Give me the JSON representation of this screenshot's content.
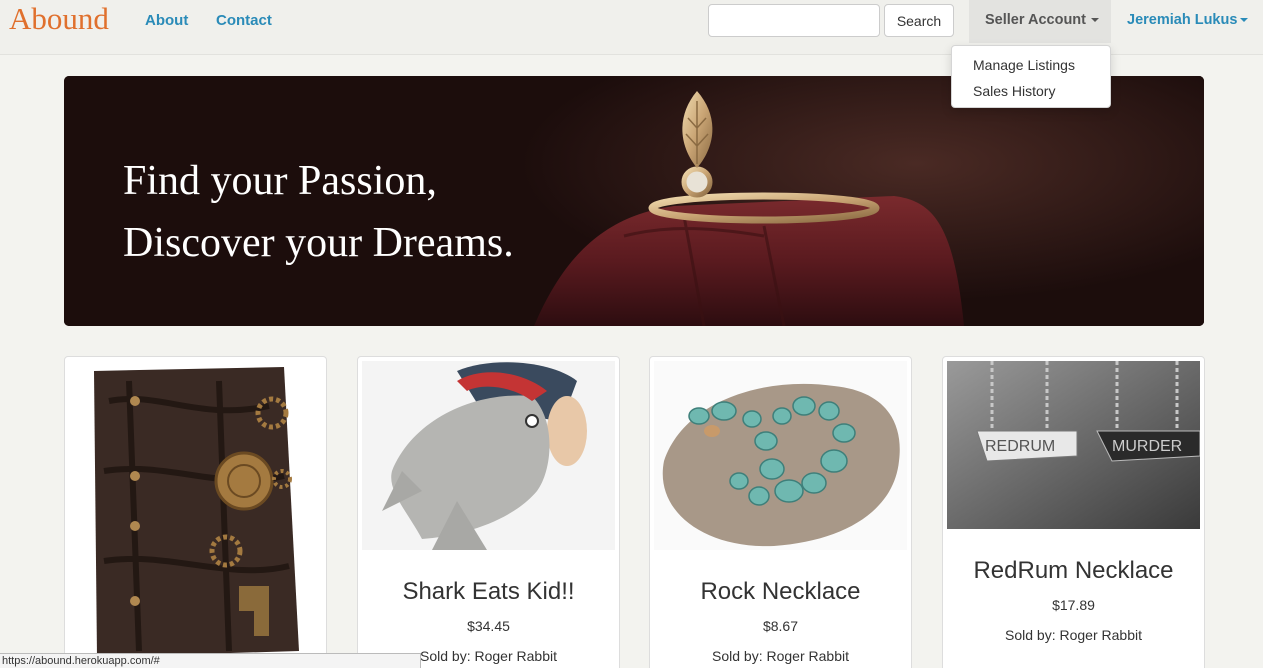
{
  "nav": {
    "brand": "Abound",
    "links": [
      "About",
      "Contact"
    ],
    "search": {
      "placeholder": "",
      "button": "Search"
    },
    "seller_menu": "Seller Account",
    "user_menu": "Jeremiah Lukus",
    "dropdown": [
      "Manage Listings",
      "Sales History"
    ]
  },
  "hero": {
    "line1": "Find your Passion,",
    "line2": "Discover your Dreams."
  },
  "products": [
    {
      "title": "",
      "price": "",
      "seller": ""
    },
    {
      "title": "Shark Eats Kid!!",
      "price": "$34.45",
      "seller": "Sold by: Roger Rabbit"
    },
    {
      "title": "Rock Necklace",
      "price": "$8.67",
      "seller": "Sold by: Roger Rabbit"
    },
    {
      "title": "RedRum Necklace",
      "price": "$17.89",
      "seller": "Sold by: Roger Rabbit"
    }
  ],
  "status_url": "https://abound.herokuapp.com/#"
}
